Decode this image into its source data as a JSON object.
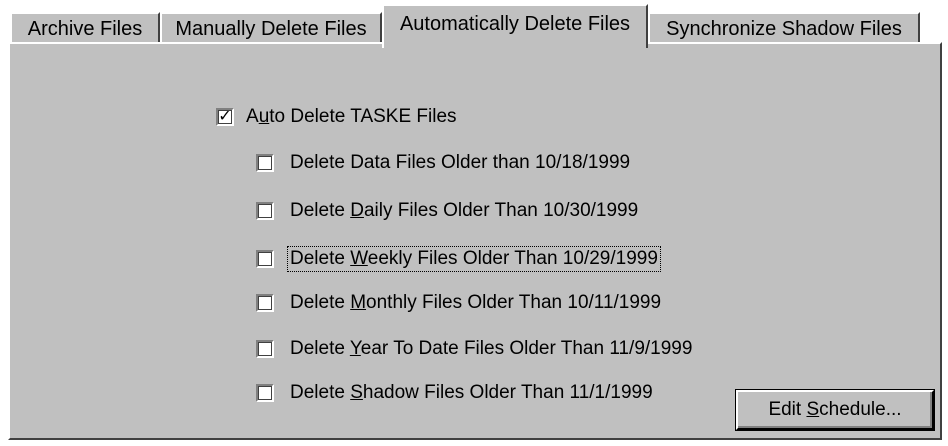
{
  "tabs": [
    {
      "label": "Archive Files",
      "active": false
    },
    {
      "label": "Manually Delete Files",
      "active": false
    },
    {
      "label": "Automatically Delete Files",
      "active": true
    },
    {
      "label": "Synchronize Shadow Files",
      "active": false
    }
  ],
  "auto_delete": {
    "label": "Auto Delete TASKE Files",
    "checked": true
  },
  "options": [
    {
      "label": "Delete Data Files Older than 10/18/1999",
      "checked": false
    },
    {
      "label": "Delete Daily Files Older Than 10/30/1999",
      "checked": false
    },
    {
      "label": "Delete Weekly Files Older Than 10/29/1999",
      "checked": false,
      "focused": true
    },
    {
      "label": "Delete Monthly Files Older Than 10/11/1999",
      "checked": false
    },
    {
      "label": "Delete Year To Date Files Older Than 11/9/1999",
      "checked": false
    },
    {
      "label": "Delete Shadow Files Older Than 11/1/1999",
      "checked": false
    }
  ],
  "edit_schedule_label": "Edit Schedule...",
  "colors": {
    "face": "#c0c0c0",
    "highlight": "#ffffff",
    "shadow": "#808080",
    "dark_shadow": "#404040"
  }
}
